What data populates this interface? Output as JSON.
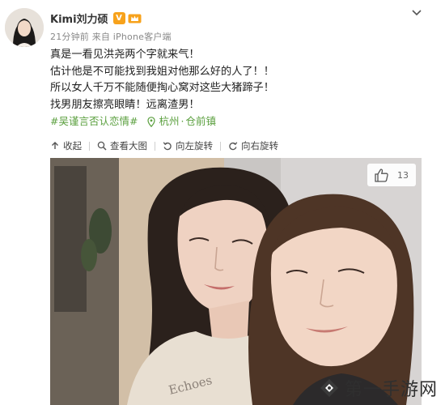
{
  "post": {
    "username": "Kimi刘力硕",
    "vip_badge": "V",
    "meta": "21分钟前 来自 iPhone客户端",
    "lines": [
      "真是一看见洪尧两个字就来气！",
      "估计他是不可能找到我姐对他那么好的人了！！",
      "所以女人千万不能随便掏心窝对这些大猪蹄子！",
      "找男朋友擦亮眼睛！远离渣男！"
    ],
    "hashtag": "#吴谨言否认恋情#",
    "location": "杭州",
    "sublocation": "仓前镇"
  },
  "toolbar": {
    "collect": "收起",
    "view_large": "查看大图",
    "rotate_left": "向左旋转",
    "rotate_right": "向右旋转"
  },
  "photo": {
    "like_count": "13",
    "shirt_text": "Echoes"
  },
  "watermark": {
    "text": "第一手游网"
  },
  "colors": {
    "tag_green": "#5a9f3e",
    "vip_orange": "#f7a21b"
  }
}
